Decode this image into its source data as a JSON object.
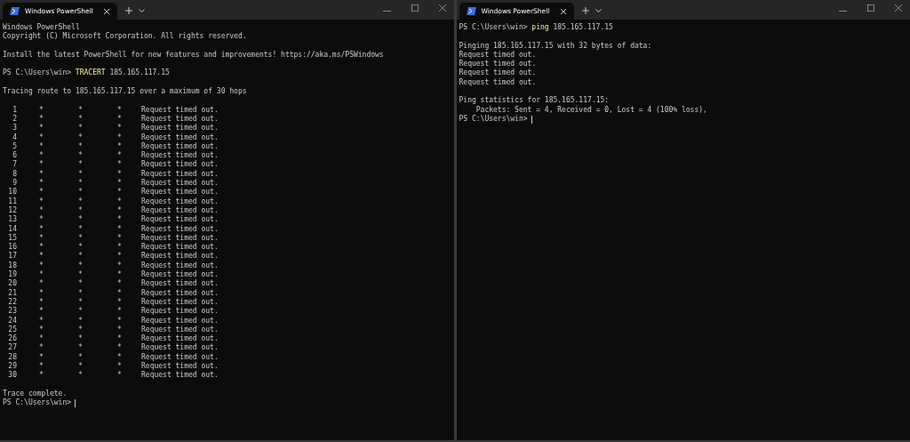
{
  "windows": [
    {
      "tab": {
        "title": "Windows PowerShell",
        "selected": true
      },
      "lines": [
        {
          "kind": "text",
          "text": "Windows PowerShell"
        },
        {
          "kind": "text",
          "text": "Copyright (C) Microsoft Corporation. All rights reserved."
        },
        {
          "kind": "blank"
        },
        {
          "kind": "text",
          "text": "Install the latest PowerShell for new features and improvements! https://aka.ms/PSWindows"
        },
        {
          "kind": "blank"
        },
        {
          "kind": "prompt",
          "prompt": "PS C:\\Users\\win>",
          "command": "TRACERT",
          "args": "185.165.117.15",
          "cursor": false
        },
        {
          "kind": "blank"
        },
        {
          "kind": "text",
          "text": "Tracing route to 185.165.117.15 over a maximum of 30 hops"
        },
        {
          "kind": "blank"
        },
        {
          "kind": "hop",
          "hop": "1",
          "probes": [
            "*",
            "*",
            "*"
          ],
          "message": "Request timed out."
        },
        {
          "kind": "hop",
          "hop": "2",
          "probes": [
            "*",
            "*",
            "*"
          ],
          "message": "Request timed out."
        },
        {
          "kind": "hop",
          "hop": "3",
          "probes": [
            "*",
            "*",
            "*"
          ],
          "message": "Request timed out."
        },
        {
          "kind": "hop",
          "hop": "4",
          "probes": [
            "*",
            "*",
            "*"
          ],
          "message": "Request timed out."
        },
        {
          "kind": "hop",
          "hop": "5",
          "probes": [
            "*",
            "*",
            "*"
          ],
          "message": "Request timed out."
        },
        {
          "kind": "hop",
          "hop": "6",
          "probes": [
            "*",
            "*",
            "*"
          ],
          "message": "Request timed out."
        },
        {
          "kind": "hop",
          "hop": "7",
          "probes": [
            "*",
            "*",
            "*"
          ],
          "message": "Request timed out."
        },
        {
          "kind": "hop",
          "hop": "8",
          "probes": [
            "*",
            "*",
            "*"
          ],
          "message": "Request timed out."
        },
        {
          "kind": "hop",
          "hop": "9",
          "probes": [
            "*",
            "*",
            "*"
          ],
          "message": "Request timed out."
        },
        {
          "kind": "hop",
          "hop": "10",
          "probes": [
            "*",
            "*",
            "*"
          ],
          "message": "Request timed out."
        },
        {
          "kind": "hop",
          "hop": "11",
          "probes": [
            "*",
            "*",
            "*"
          ],
          "message": "Request timed out."
        },
        {
          "kind": "hop",
          "hop": "12",
          "probes": [
            "*",
            "*",
            "*"
          ],
          "message": "Request timed out."
        },
        {
          "kind": "hop",
          "hop": "13",
          "probes": [
            "*",
            "*",
            "*"
          ],
          "message": "Request timed out."
        },
        {
          "kind": "hop",
          "hop": "14",
          "probes": [
            "*",
            "*",
            "*"
          ],
          "message": "Request timed out."
        },
        {
          "kind": "hop",
          "hop": "15",
          "probes": [
            "*",
            "*",
            "*"
          ],
          "message": "Request timed out."
        },
        {
          "kind": "hop",
          "hop": "16",
          "probes": [
            "*",
            "*",
            "*"
          ],
          "message": "Request timed out."
        },
        {
          "kind": "hop",
          "hop": "17",
          "probes": [
            "*",
            "*",
            "*"
          ],
          "message": "Request timed out."
        },
        {
          "kind": "hop",
          "hop": "18",
          "probes": [
            "*",
            "*",
            "*"
          ],
          "message": "Request timed out."
        },
        {
          "kind": "hop",
          "hop": "19",
          "probes": [
            "*",
            "*",
            "*"
          ],
          "message": "Request timed out."
        },
        {
          "kind": "hop",
          "hop": "20",
          "probes": [
            "*",
            "*",
            "*"
          ],
          "message": "Request timed out."
        },
        {
          "kind": "hop",
          "hop": "21",
          "probes": [
            "*",
            "*",
            "*"
          ],
          "message": "Request timed out."
        },
        {
          "kind": "hop",
          "hop": "22",
          "probes": [
            "*",
            "*",
            "*"
          ],
          "message": "Request timed out."
        },
        {
          "kind": "hop",
          "hop": "23",
          "probes": [
            "*",
            "*",
            "*"
          ],
          "message": "Request timed out."
        },
        {
          "kind": "hop",
          "hop": "24",
          "probes": [
            "*",
            "*",
            "*"
          ],
          "message": "Request timed out."
        },
        {
          "kind": "hop",
          "hop": "25",
          "probes": [
            "*",
            "*",
            "*"
          ],
          "message": "Request timed out."
        },
        {
          "kind": "hop",
          "hop": "26",
          "probes": [
            "*",
            "*",
            "*"
          ],
          "message": "Request timed out."
        },
        {
          "kind": "hop",
          "hop": "27",
          "probes": [
            "*",
            "*",
            "*"
          ],
          "message": "Request timed out."
        },
        {
          "kind": "hop",
          "hop": "28",
          "probes": [
            "*",
            "*",
            "*"
          ],
          "message": "Request timed out."
        },
        {
          "kind": "hop",
          "hop": "29",
          "probes": [
            "*",
            "*",
            "*"
          ],
          "message": "Request timed out."
        },
        {
          "kind": "hop",
          "hop": "30",
          "probes": [
            "*",
            "*",
            "*"
          ],
          "message": "Request timed out."
        },
        {
          "kind": "blank"
        },
        {
          "kind": "text",
          "text": "Trace complete."
        },
        {
          "kind": "prompt",
          "prompt": "PS C:\\Users\\win>",
          "cursor": true
        }
      ]
    },
    {
      "tab": {
        "title": "Windows PowerShell",
        "selected": true
      },
      "lines": [
        {
          "kind": "prompt",
          "prompt": "PS C:\\Users\\win>",
          "command": "ping",
          "args": "185.165.117.15",
          "cursor": false
        },
        {
          "kind": "blank"
        },
        {
          "kind": "text",
          "text": "Pinging 185.165.117.15 with 32 bytes of data:"
        },
        {
          "kind": "text",
          "text": "Request timed out."
        },
        {
          "kind": "text",
          "text": "Request timed out."
        },
        {
          "kind": "text",
          "text": "Request timed out."
        },
        {
          "kind": "text",
          "text": "Request timed out."
        },
        {
          "kind": "blank"
        },
        {
          "kind": "text",
          "text": "Ping statistics for 185.165.117.15:"
        },
        {
          "kind": "text",
          "text": "    Packets: Sent = 4, Received = 0, Lost = 4 (100% loss),"
        },
        {
          "kind": "prompt",
          "prompt": "PS C:\\Users\\win>",
          "cursor": true
        }
      ]
    }
  ]
}
